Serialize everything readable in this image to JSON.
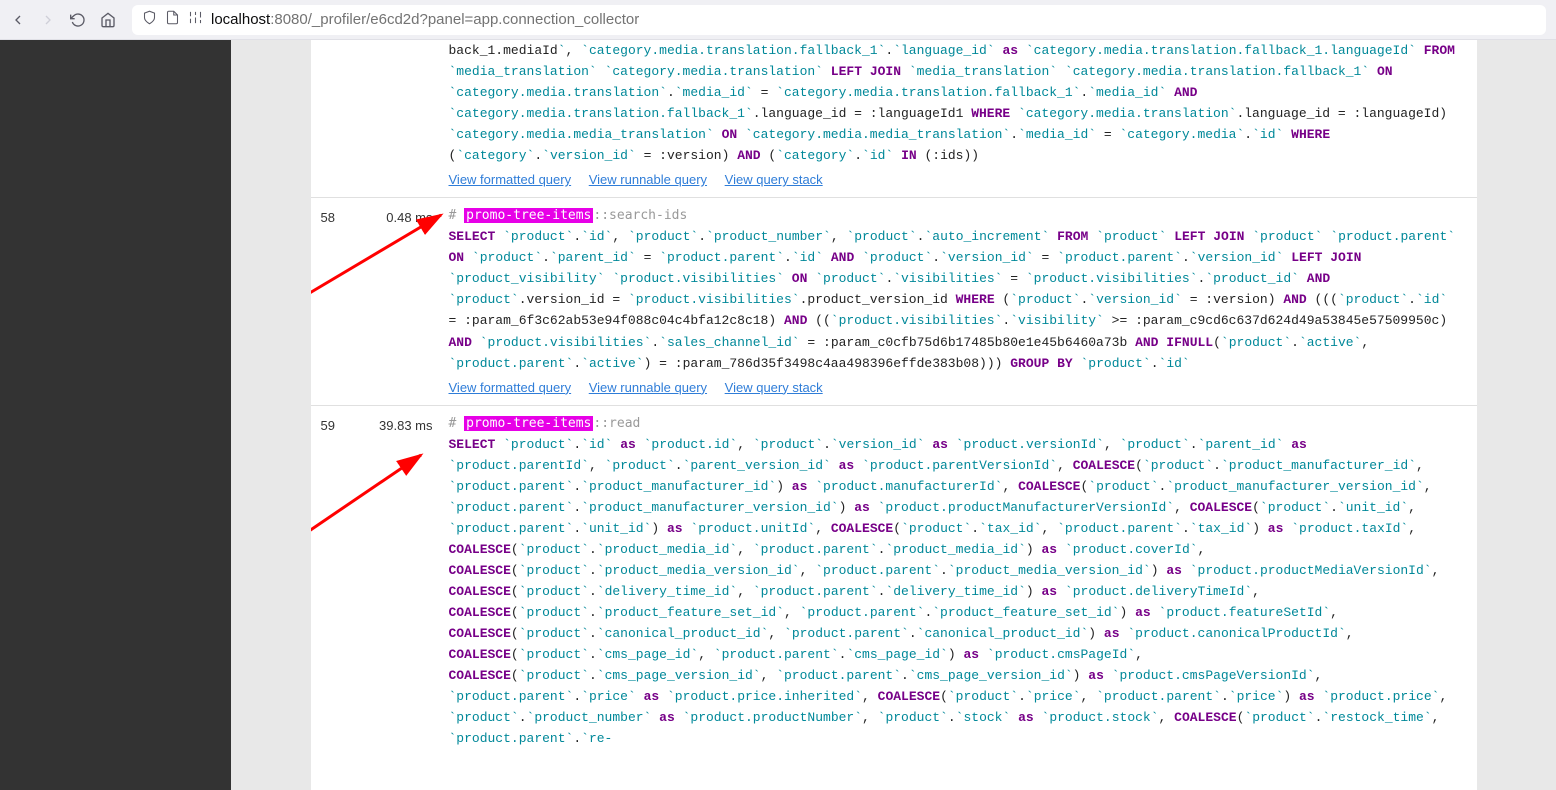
{
  "browser": {
    "url_host": "localhost",
    "url_rest": ":8080/_profiler/e6cd2d?panel=app.connection_collector"
  },
  "links": {
    "formatted": "View formatted query",
    "runnable": "View runnable query",
    "stack": "View query stack"
  },
  "queries": [
    {
      "num": "58",
      "time": "0.48 ms",
      "tag": "promo-tree-items",
      "tag_suffix": "::search-ids"
    },
    {
      "num": "59",
      "time": "39.83 ms",
      "tag": "promo-tree-items",
      "tag_suffix": "::read"
    }
  ],
  "sql57_fragment_tokens": [
    [
      "plain",
      "back_1.mediaId"
    ],
    [
      "bt",
      "`"
    ],
    [
      "plain",
      ", "
    ],
    [
      "bt",
      "`category.media.translation.fallback_1`"
    ],
    [
      "plain",
      "."
    ],
    [
      "bt",
      "`language_id`"
    ],
    [
      "plain",
      " "
    ],
    [
      "kw",
      "as"
    ],
    [
      "plain",
      " "
    ],
    [
      "bt",
      "`category.media.translation.fall­back_1.languageId`"
    ],
    [
      "plain",
      " "
    ],
    [
      "kw",
      "FROM"
    ],
    [
      "plain",
      " "
    ],
    [
      "bt",
      "`media_translation`"
    ],
    [
      "plain",
      " "
    ],
    [
      "bt",
      "`category.media.translation`"
    ],
    [
      "plain",
      " "
    ],
    [
      "kw",
      "LEFT"
    ],
    [
      "plain",
      " "
    ],
    [
      "kw",
      "JOIN"
    ],
    [
      "plain",
      " "
    ],
    [
      "bt",
      "`media_translation`"
    ],
    [
      "plain",
      " "
    ],
    [
      "bt",
      "`category.me­dia.translation.fallback_1`"
    ],
    [
      "plain",
      " "
    ],
    [
      "kw",
      "ON"
    ],
    [
      "plain",
      " "
    ],
    [
      "bt",
      "`category.media.translation`"
    ],
    [
      "plain",
      "."
    ],
    [
      "bt",
      "`media_id`"
    ],
    [
      "plain",
      " = "
    ],
    [
      "bt",
      "`category.media.translation.fall­back_1`"
    ],
    [
      "plain",
      "."
    ],
    [
      "bt",
      "`media_id`"
    ],
    [
      "plain",
      " "
    ],
    [
      "kw",
      "AND"
    ],
    [
      "plain",
      " "
    ],
    [
      "bt",
      "`category.media.translation.fallback_1`"
    ],
    [
      "plain",
      ".language_id = :languageId1 "
    ],
    [
      "kw",
      "WHERE"
    ],
    [
      "plain",
      " "
    ],
    [
      "bt",
      "`category.me­dia.translation`"
    ],
    [
      "plain",
      ".language_id = :languageId) "
    ],
    [
      "bt",
      "`category.media.media_translation`"
    ],
    [
      "plain",
      " "
    ],
    [
      "kw",
      "ON"
    ],
    [
      "plain",
      " "
    ],
    [
      "bt",
      "`category.media.media_transla­tion`"
    ],
    [
      "plain",
      "."
    ],
    [
      "bt",
      "`media_id`"
    ],
    [
      "plain",
      " = "
    ],
    [
      "bt",
      "`category.media`"
    ],
    [
      "plain",
      "."
    ],
    [
      "bt",
      "`id`"
    ],
    [
      "plain",
      " "
    ],
    [
      "kw",
      "WHERE"
    ],
    [
      "plain",
      " ("
    ],
    [
      "bt",
      "`category`"
    ],
    [
      "plain",
      "."
    ],
    [
      "bt",
      "`version_id`"
    ],
    [
      "plain",
      " = :version) "
    ],
    [
      "kw",
      "AND"
    ],
    [
      "plain",
      " ("
    ],
    [
      "bt",
      "`category`"
    ],
    [
      "plain",
      "."
    ],
    [
      "bt",
      "`id`"
    ],
    [
      "plain",
      " "
    ],
    [
      "kw",
      "IN"
    ],
    [
      "plain",
      " (:ids))"
    ]
  ],
  "sql58_tokens": [
    [
      "kw",
      "SELECT"
    ],
    [
      "plain",
      " "
    ],
    [
      "bt",
      "`product`"
    ],
    [
      "plain",
      "."
    ],
    [
      "bt",
      "`id`"
    ],
    [
      "plain",
      ", "
    ],
    [
      "bt",
      "`product`"
    ],
    [
      "plain",
      "."
    ],
    [
      "bt",
      "`product_number`"
    ],
    [
      "plain",
      ", "
    ],
    [
      "bt",
      "`product`"
    ],
    [
      "plain",
      "."
    ],
    [
      "bt",
      "`auto_increment`"
    ],
    [
      "plain",
      " "
    ],
    [
      "kw",
      "FROM"
    ],
    [
      "plain",
      " "
    ],
    [
      "bt",
      "`product`"
    ],
    [
      "plain",
      " "
    ],
    [
      "kw",
      "LEFT"
    ],
    [
      "plain",
      " "
    ],
    [
      "kw",
      "JOIN"
    ],
    [
      "plain",
      " "
    ],
    [
      "bt",
      "`product`"
    ],
    [
      "plain",
      " "
    ],
    [
      "bt",
      "`product.parent`"
    ],
    [
      "plain",
      " "
    ],
    [
      "kw",
      "ON"
    ],
    [
      "plain",
      " "
    ],
    [
      "bt",
      "`product`"
    ],
    [
      "plain",
      "."
    ],
    [
      "bt",
      "`parent_id`"
    ],
    [
      "plain",
      " = "
    ],
    [
      "bt",
      "`product.parent`"
    ],
    [
      "plain",
      "."
    ],
    [
      "bt",
      "`id`"
    ],
    [
      "plain",
      " "
    ],
    [
      "kw",
      "AND"
    ],
    [
      "plain",
      " "
    ],
    [
      "bt",
      "`product`"
    ],
    [
      "plain",
      "."
    ],
    [
      "bt",
      "`version_id`"
    ],
    [
      "plain",
      " = "
    ],
    [
      "bt",
      "`product.par­ent`"
    ],
    [
      "plain",
      "."
    ],
    [
      "bt",
      "`version_id`"
    ],
    [
      "plain",
      " "
    ],
    [
      "kw",
      "LEFT"
    ],
    [
      "plain",
      " "
    ],
    [
      "kw",
      "JOIN"
    ],
    [
      "plain",
      " "
    ],
    [
      "bt",
      "`product_visibility`"
    ],
    [
      "plain",
      " "
    ],
    [
      "bt",
      "`product.visibilities`"
    ],
    [
      "plain",
      " "
    ],
    [
      "kw",
      "ON"
    ],
    [
      "plain",
      " "
    ],
    [
      "bt",
      "`product`"
    ],
    [
      "plain",
      "."
    ],
    [
      "bt",
      "`visibilities`"
    ],
    [
      "plain",
      " = "
    ],
    [
      "bt",
      "`product.visi­bilities`"
    ],
    [
      "plain",
      "."
    ],
    [
      "bt",
      "`product_id`"
    ],
    [
      "plain",
      " "
    ],
    [
      "kw",
      "AND"
    ],
    [
      "plain",
      " "
    ],
    [
      "bt",
      "`product`"
    ],
    [
      "plain",
      ".version_id = "
    ],
    [
      "bt",
      "`product.visibilities`"
    ],
    [
      "plain",
      ".product_version_id "
    ],
    [
      "kw",
      "WHERE"
    ],
    [
      "plain",
      " ("
    ],
    [
      "bt",
      "`product`"
    ],
    [
      "plain",
      "."
    ],
    [
      "bt",
      "`ver­sion_id`"
    ],
    [
      "plain",
      " = :version) "
    ],
    [
      "kw",
      "AND"
    ],
    [
      "plain",
      " ((("
    ],
    [
      "bt",
      "`product`"
    ],
    [
      "plain",
      "."
    ],
    [
      "bt",
      "`id`"
    ],
    [
      "plain",
      " = :param_6f3c62ab53e94f088c04c4bfa12c8c18) "
    ],
    [
      "kw",
      "AND"
    ],
    [
      "plain",
      " (("
    ],
    [
      "bt",
      "`product.visibili­ties`"
    ],
    [
      "plain",
      "."
    ],
    [
      "bt",
      "`visibility`"
    ],
    [
      "plain",
      " >= :param_c9cd6c637d624d49a53845e57509950c) "
    ],
    [
      "kw",
      "AND"
    ],
    [
      "plain",
      " "
    ],
    [
      "bt",
      "`product.visibilities`"
    ],
    [
      "plain",
      "."
    ],
    [
      "bt",
      "`sales_channel_id`"
    ],
    [
      "plain",
      " = :param_c0cfb75d6b17485b80e1e45b6460a73b "
    ],
    [
      "kw",
      "AND"
    ],
    [
      "plain",
      " "
    ],
    [
      "kw",
      "IFNULL"
    ],
    [
      "plain",
      "("
    ],
    [
      "bt",
      "`product`"
    ],
    [
      "plain",
      "."
    ],
    [
      "bt",
      "`active`"
    ],
    [
      "plain",
      ", "
    ],
    [
      "bt",
      "`product.parent`"
    ],
    [
      "plain",
      "."
    ],
    [
      "bt",
      "`active`"
    ],
    [
      "plain",
      ") = :param_786d35f3498c4aa498396effde383b08))) "
    ],
    [
      "kw",
      "GROUP"
    ],
    [
      "plain",
      " "
    ],
    [
      "kw",
      "BY"
    ],
    [
      "plain",
      " "
    ],
    [
      "bt",
      "`product`"
    ],
    [
      "plain",
      "."
    ],
    [
      "bt",
      "`id`"
    ]
  ],
  "sql59_tokens": [
    [
      "kw",
      "SELECT"
    ],
    [
      "plain",
      " "
    ],
    [
      "bt",
      "`product`"
    ],
    [
      "plain",
      "."
    ],
    [
      "bt",
      "`id`"
    ],
    [
      "plain",
      " "
    ],
    [
      "kw",
      "as"
    ],
    [
      "plain",
      " "
    ],
    [
      "bt",
      "`product.id`"
    ],
    [
      "plain",
      ", "
    ],
    [
      "bt",
      "`product`"
    ],
    [
      "plain",
      "."
    ],
    [
      "bt",
      "`version_id`"
    ],
    [
      "plain",
      " "
    ],
    [
      "kw",
      "as"
    ],
    [
      "plain",
      " "
    ],
    [
      "bt",
      "`product.versionId`"
    ],
    [
      "plain",
      ", "
    ],
    [
      "bt",
      "`product`"
    ],
    [
      "plain",
      "."
    ],
    [
      "bt",
      "`parent_id`"
    ],
    [
      "plain",
      " "
    ],
    [
      "kw",
      "as"
    ],
    [
      "plain",
      " "
    ],
    [
      "bt",
      "`product.parentId`"
    ],
    [
      "plain",
      ", "
    ],
    [
      "bt",
      "`product`"
    ],
    [
      "plain",
      "."
    ],
    [
      "bt",
      "`parent_version_id`"
    ],
    [
      "plain",
      " "
    ],
    [
      "kw",
      "as"
    ],
    [
      "plain",
      " "
    ],
    [
      "bt",
      "`product.parentVersionId`"
    ],
    [
      "plain",
      ", "
    ],
    [
      "kw",
      "COALESCE"
    ],
    [
      "plain",
      "("
    ],
    [
      "bt",
      "`product`"
    ],
    [
      "plain",
      "."
    ],
    [
      "bt",
      "`product_manufac­turer_id`"
    ],
    [
      "plain",
      ", "
    ],
    [
      "bt",
      "`product.parent`"
    ],
    [
      "plain",
      "."
    ],
    [
      "bt",
      "`product_manufacturer_id`"
    ],
    [
      "plain",
      ") "
    ],
    [
      "kw",
      "as"
    ],
    [
      "plain",
      " "
    ],
    [
      "bt",
      "`product.manufacturerId`"
    ],
    [
      "plain",
      ", "
    ],
    [
      "kw",
      "COALESCE"
    ],
    [
      "plain",
      "("
    ],
    [
      "bt",
      "`product`"
    ],
    [
      "plain",
      "."
    ],
    [
      "bt",
      "`product_man­ufacturer_version_id`"
    ],
    [
      "plain",
      ", "
    ],
    [
      "bt",
      "`product.parent`"
    ],
    [
      "plain",
      "."
    ],
    [
      "bt",
      "`product_manufacturer_version_id`"
    ],
    [
      "plain",
      ") "
    ],
    [
      "kw",
      "as"
    ],
    [
      "plain",
      " "
    ],
    [
      "bt",
      "`prod­uct.productManufacturerVersionId`"
    ],
    [
      "plain",
      ", "
    ],
    [
      "kw",
      "COALESCE"
    ],
    [
      "plain",
      "("
    ],
    [
      "bt",
      "`product`"
    ],
    [
      "plain",
      "."
    ],
    [
      "bt",
      "`unit_id`"
    ],
    [
      "plain",
      ", "
    ],
    [
      "bt",
      "`product.parent`"
    ],
    [
      "plain",
      "."
    ],
    [
      "bt",
      "`unit_id`"
    ],
    [
      "plain",
      ") "
    ],
    [
      "kw",
      "as"
    ],
    [
      "plain",
      " "
    ],
    [
      "bt",
      "`product.unitId`"
    ],
    [
      "plain",
      ", "
    ],
    [
      "kw",
      "COALESCE"
    ],
    [
      "plain",
      "("
    ],
    [
      "bt",
      "`product`"
    ],
    [
      "plain",
      "."
    ],
    [
      "bt",
      "`tax_id`"
    ],
    [
      "plain",
      ", "
    ],
    [
      "bt",
      "`product.parent`"
    ],
    [
      "plain",
      "."
    ],
    [
      "bt",
      "`tax_id`"
    ],
    [
      "plain",
      ") "
    ],
    [
      "kw",
      "as"
    ],
    [
      "plain",
      " "
    ],
    [
      "bt",
      "`product.taxId`"
    ],
    [
      "plain",
      ", "
    ],
    [
      "kw",
      "COALESCE"
    ],
    [
      "plain",
      "("
    ],
    [
      "bt",
      "`product`"
    ],
    [
      "plain",
      "."
    ],
    [
      "bt",
      "`product_media_id`"
    ],
    [
      "plain",
      ", "
    ],
    [
      "bt",
      "`product.parent`"
    ],
    [
      "plain",
      "."
    ],
    [
      "bt",
      "`product_media_id`"
    ],
    [
      "plain",
      ") "
    ],
    [
      "kw",
      "as"
    ],
    [
      "plain",
      " "
    ],
    [
      "bt",
      "`product.coverId`"
    ],
    [
      "plain",
      ", "
    ],
    [
      "kw",
      "COALESCE"
    ],
    [
      "plain",
      "("
    ],
    [
      "bt",
      "`product`"
    ],
    [
      "plain",
      "."
    ],
    [
      "bt",
      "`product_media_version_id`"
    ],
    [
      "plain",
      ", "
    ],
    [
      "bt",
      "`prod­uct.parent`"
    ],
    [
      "plain",
      "."
    ],
    [
      "bt",
      "`product_media_version_id`"
    ],
    [
      "plain",
      ") "
    ],
    [
      "kw",
      "as"
    ],
    [
      "plain",
      " "
    ],
    [
      "bt",
      "`product.productMediaVersionId`"
    ],
    [
      "plain",
      ", "
    ],
    [
      "kw",
      "COALESCE"
    ],
    [
      "plain",
      "("
    ],
    [
      "bt",
      "`product`"
    ],
    [
      "plain",
      "."
    ],
    [
      "bt",
      "`delivery_time_id`"
    ],
    [
      "plain",
      ", "
    ],
    [
      "bt",
      "`product.parent`"
    ],
    [
      "plain",
      "."
    ],
    [
      "bt",
      "`delivery_time_id`"
    ],
    [
      "plain",
      ") "
    ],
    [
      "kw",
      "as"
    ],
    [
      "plain",
      " "
    ],
    [
      "bt",
      "`product.deliveryTimeId`"
    ],
    [
      "plain",
      ", "
    ],
    [
      "kw",
      "COALESCE"
    ],
    [
      "plain",
      "("
    ],
    [
      "bt",
      "`product`"
    ],
    [
      "plain",
      "."
    ],
    [
      "bt",
      "`product_feature_set_id`"
    ],
    [
      "plain",
      ", "
    ],
    [
      "bt",
      "`product.parent`"
    ],
    [
      "plain",
      "."
    ],
    [
      "bt",
      "`product_feature_set_id`"
    ],
    [
      "plain",
      ") "
    ],
    [
      "kw",
      "as"
    ],
    [
      "plain",
      " "
    ],
    [
      "bt",
      "`product.featureSetId`"
    ],
    [
      "plain",
      ", "
    ],
    [
      "kw",
      "COALESCE"
    ],
    [
      "plain",
      "("
    ],
    [
      "bt",
      "`product`"
    ],
    [
      "plain",
      "."
    ],
    [
      "bt",
      "`canonical_product_id`"
    ],
    [
      "plain",
      ", "
    ],
    [
      "bt",
      "`product.parent`"
    ],
    [
      "plain",
      "."
    ],
    [
      "bt",
      "`canonical_product_id`"
    ],
    [
      "plain",
      ") "
    ],
    [
      "kw",
      "as"
    ],
    [
      "plain",
      " "
    ],
    [
      "bt",
      "`product.canonicalProductId`"
    ],
    [
      "plain",
      ", "
    ],
    [
      "kw",
      "COALESCE"
    ],
    [
      "plain",
      "("
    ],
    [
      "bt",
      "`product`"
    ],
    [
      "plain",
      "."
    ],
    [
      "bt",
      "`cms_page_id`"
    ],
    [
      "plain",
      ", "
    ],
    [
      "bt",
      "`prod­uct.parent`"
    ],
    [
      "plain",
      "."
    ],
    [
      "bt",
      "`cms_page_id`"
    ],
    [
      "plain",
      ") "
    ],
    [
      "kw",
      "as"
    ],
    [
      "plain",
      " "
    ],
    [
      "bt",
      "`product.cmsPageId`"
    ],
    [
      "plain",
      ", "
    ],
    [
      "kw",
      "COALESCE"
    ],
    [
      "plain",
      "("
    ],
    [
      "bt",
      "`product`"
    ],
    [
      "plain",
      "."
    ],
    [
      "bt",
      "`cms_page_version_id`"
    ],
    [
      "plain",
      ", "
    ],
    [
      "bt",
      "`product.par­ent`"
    ],
    [
      "plain",
      "."
    ],
    [
      "bt",
      "`cms_page_version_id`"
    ],
    [
      "plain",
      ") "
    ],
    [
      "kw",
      "as"
    ],
    [
      "plain",
      " "
    ],
    [
      "bt",
      "`product.cmsPageVersionId`"
    ],
    [
      "plain",
      ", "
    ],
    [
      "bt",
      "`product.parent`"
    ],
    [
      "plain",
      "."
    ],
    [
      "bt",
      "`price`"
    ],
    [
      "plain",
      " "
    ],
    [
      "kw",
      "as"
    ],
    [
      "plain",
      " "
    ],
    [
      "bt",
      "`product.price.inherited`"
    ],
    [
      "plain",
      ", "
    ],
    [
      "kw",
      "COALESCE"
    ],
    [
      "plain",
      "("
    ],
    [
      "bt",
      "`product`"
    ],
    [
      "plain",
      "."
    ],
    [
      "bt",
      "`price`"
    ],
    [
      "plain",
      ", "
    ],
    [
      "bt",
      "`product.parent`"
    ],
    [
      "plain",
      "."
    ],
    [
      "bt",
      "`price`"
    ],
    [
      "plain",
      ") "
    ],
    [
      "kw",
      "as"
    ],
    [
      "plain",
      " "
    ],
    [
      "bt",
      "`product.price`"
    ],
    [
      "plain",
      ", "
    ],
    [
      "bt",
      "`product`"
    ],
    [
      "plain",
      "."
    ],
    [
      "bt",
      "`product_number`"
    ],
    [
      "plain",
      " "
    ],
    [
      "kw",
      "as"
    ],
    [
      "plain",
      " "
    ],
    [
      "bt",
      "`prod­uct.productNumber`"
    ],
    [
      "plain",
      ", "
    ],
    [
      "bt",
      "`product`"
    ],
    [
      "plain",
      "."
    ],
    [
      "bt",
      "`stock`"
    ],
    [
      "plain",
      " "
    ],
    [
      "kw",
      "as"
    ],
    [
      "plain",
      " "
    ],
    [
      "bt",
      "`product.stock`"
    ],
    [
      "plain",
      ", "
    ],
    [
      "kw",
      "COALESCE"
    ],
    [
      "plain",
      "("
    ],
    [
      "bt",
      "`product`"
    ],
    [
      "plain",
      "."
    ],
    [
      "bt",
      "`restock_time`"
    ],
    [
      "plain",
      ", "
    ],
    [
      "bt",
      "`product.parent`"
    ],
    [
      "plain",
      "."
    ],
    [
      "bt",
      "`re-"
    ]
  ]
}
